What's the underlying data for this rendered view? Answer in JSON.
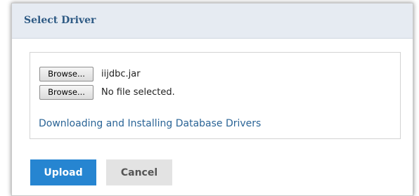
{
  "dialog": {
    "title": "Select Driver"
  },
  "files": [
    {
      "browse_label": "Browse...",
      "file_name": "iijdbc.jar"
    },
    {
      "browse_label": "Browse...",
      "file_name": "No file selected."
    }
  ],
  "help_link": "Downloading and Installing Database Drivers",
  "actions": {
    "upload_label": "Upload",
    "cancel_label": "Cancel"
  },
  "colors": {
    "header_bg": "#e6ebf2",
    "title": "#2e5a84",
    "link": "#2a6496",
    "primary": "#2685d1",
    "secondary": "#e3e3e3"
  }
}
